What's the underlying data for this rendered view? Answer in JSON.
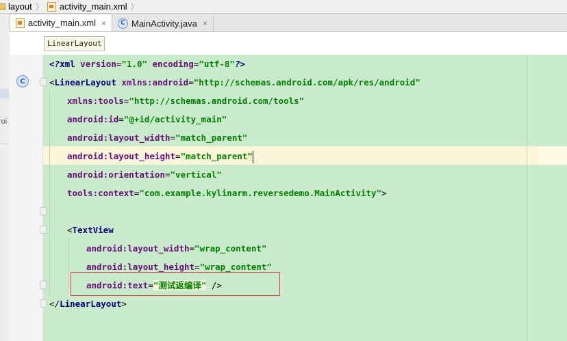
{
  "breadcrumb": {
    "items": [
      "layout",
      "activity_main.xml"
    ]
  },
  "tabs": [
    {
      "label": "activity_main.xml",
      "icon": "xml-file-icon",
      "active": true,
      "close": "×"
    },
    {
      "label": "MainActivity.java",
      "icon": "class-c-icon",
      "active": false,
      "close": "×"
    }
  ],
  "hint": "LinearLayout",
  "gutter": {
    "class_marker": "C"
  },
  "left_strip": {
    "text": "roi"
  },
  "code": {
    "l1": {
      "open": "<?",
      "tag": "xml",
      "a1": " version",
      "eq1": "=",
      "v1": "\"1.0\"",
      "a2": " encoding",
      "eq2": "=",
      "v2": "\"utf-8\"",
      "close": "?>"
    },
    "l2": {
      "open": "<",
      "tag": "LinearLayout",
      "a1": " xmlns:android",
      "eq": "=",
      "v1": "\"http://schemas.android.com/apk/res/android\""
    },
    "l3": {
      "a": "xmlns:tools",
      "eq": "=",
      "v": "\"http://schemas.android.com/tools\""
    },
    "l4": {
      "a": "android:id",
      "eq": "=",
      "v": "\"@+id/activity_main\""
    },
    "l5": {
      "a": "android:layout_width",
      "eq": "=",
      "v": "\"match_parent\""
    },
    "l6": {
      "a": "android:layout_height",
      "eq": "=",
      "q1": "\"",
      "v": "match_parent",
      "q2": "\""
    },
    "l7": {
      "a": "android:orientation",
      "eq": "=",
      "v": "\"vertical\""
    },
    "l8": {
      "a": "tools:context",
      "eq": "=",
      "v": "\"com.example.kylinarm.reversedemo.MainActivity\"",
      "close": ">"
    },
    "l10": {
      "open": "<",
      "tag": "TextView"
    },
    "l11": {
      "a": "android:layout_width",
      "eq": "=",
      "v": "\"wrap_content\""
    },
    "l12": {
      "a": "android:layout_height",
      "eq": "=",
      "v": "\"wrap_content\""
    },
    "l13": {
      "a": "android:text",
      "eq": "=",
      "v": "\"测试返编译\"",
      "close": " />"
    },
    "l14": {
      "open": "</",
      "tag": "LinearLayout",
      "close": ">"
    }
  }
}
